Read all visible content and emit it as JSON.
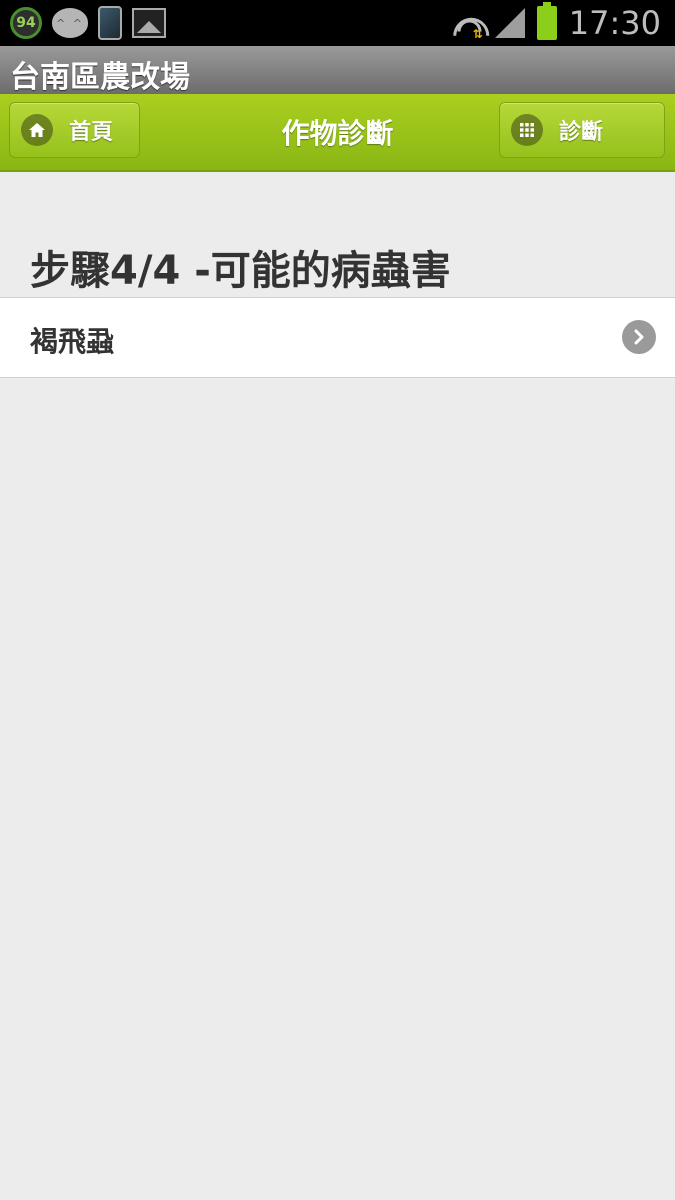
{
  "status_bar": {
    "notification_badge": "94",
    "chat_icon_text": "^ ^",
    "time": "17:30"
  },
  "app": {
    "title": "台南區農改場"
  },
  "header": {
    "home_label": "首頁",
    "page_title": "作物診斷",
    "diagnosis_label": "診斷",
    "colors": {
      "bar": "#9cc31a",
      "text": "#ffffff"
    }
  },
  "content": {
    "step_heading": "步驟4/4 -可能的病蟲害",
    "results": [
      {
        "label": "褐飛蝨",
        "icon": "chevron-right-icon"
      }
    ]
  }
}
